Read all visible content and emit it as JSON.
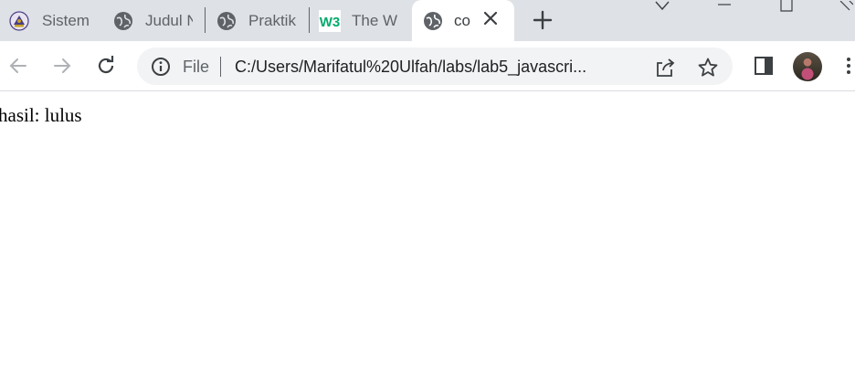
{
  "tabs": [
    {
      "title": "Sistem",
      "icon": "university-logo-icon",
      "active": false
    },
    {
      "title": "Judul N",
      "icon": "globe-icon",
      "active": false
    },
    {
      "title": "Praktik",
      "icon": "globe-icon",
      "active": false
    },
    {
      "title": "The W",
      "icon": "w3schools-icon",
      "active": false
    },
    {
      "title": "co",
      "icon": "globe-icon",
      "active": true
    }
  ],
  "w3_logo_text": "W3",
  "omnibox": {
    "scheme_label": "File",
    "url": "C:/Users/Marifatul%20Ulfah/labs/lab5_javascri..."
  },
  "page": {
    "result_text": "hasil: lulus"
  },
  "colors": {
    "tabstrip_bg": "#dee1e6",
    "omnibox_bg": "#f1f3f4",
    "icon_gray": "#5f6368",
    "w3_green": "#04aa6d"
  }
}
